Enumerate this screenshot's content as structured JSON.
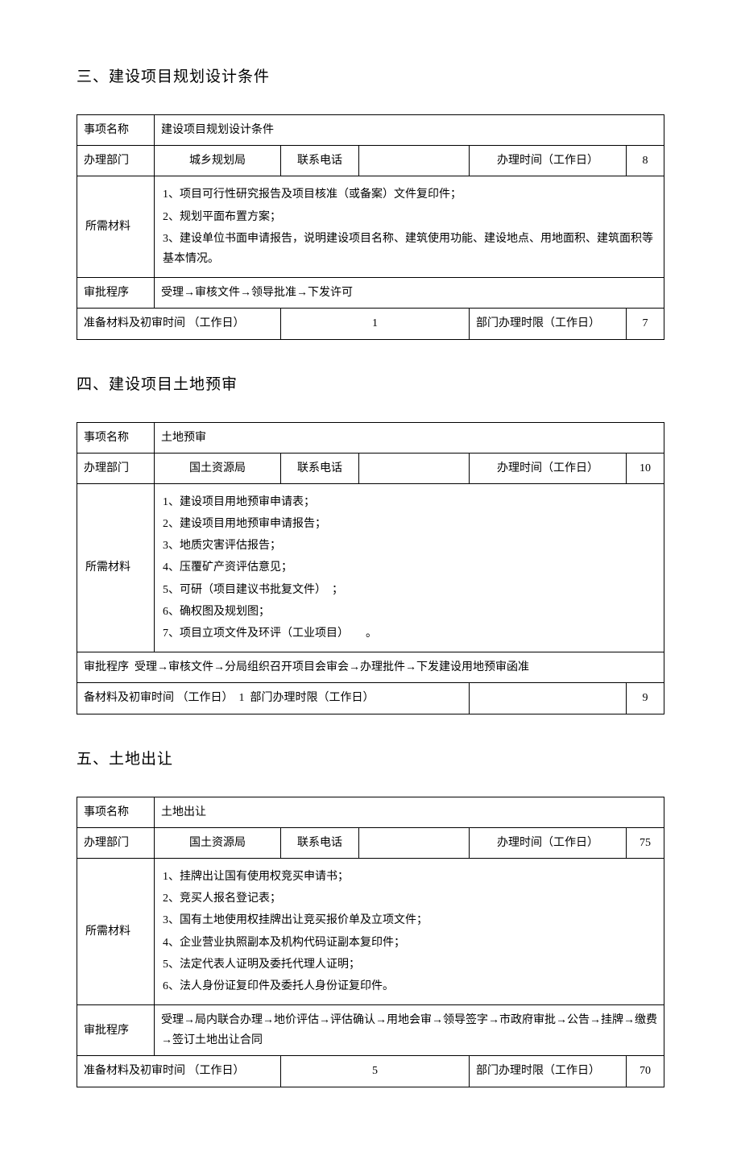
{
  "sections": [
    {
      "heading": "三、建设项目规划设计条件",
      "row_name_label": "事项名称",
      "row_name_value": "建设项目规划设计条件",
      "dept_label": "办理部门",
      "dept_value": "城乡规划局",
      "phone_label": "联系电话",
      "phone_value": "",
      "time_label": "办理时间（工作日）",
      "time_value": "8",
      "materials_label": "所需材料",
      "materials": [
        "1、项目可行性研究报告及项目核准（或备案）文件复印件；",
        "2、规划平面布置方案；",
        "3、建设单位书面申请报告，说明建设项目名称、建筑使用功能、建设地点、用地面积、建筑面积等基本情况。"
      ],
      "approval_label": "审批程序",
      "approval_value": "受理→审核文件→领导批准→下发许可",
      "prep_label": "准备材料及初审时间 （工作日）",
      "prep_value": "1",
      "dept_time_label": "部门办理时限（工作日）",
      "dept_time_value": "7"
    },
    {
      "heading": "四、建设项目土地预审",
      "row_name_label": "事项名称",
      "row_name_value": "土地预审",
      "dept_label": "办理部门",
      "dept_value": "国土资源局",
      "phone_label": "联系电话",
      "phone_value": "",
      "time_label": "办理时间（工作日）",
      "time_value": "10",
      "materials_label": "所需材料",
      "materials": [
        "1、建设项目用地预审申请表；",
        "2、建设项目用地预审申请报告；",
        "3、地质灾害评估报告；",
        "4、压覆矿产资评估意见；",
        "5、可研（项目建议书批复文件）　；",
        "6、确权图及规划图；",
        "7、项目立项文件及环评（工业项目）　　。"
      ],
      "approval_label": "审批程序",
      "approval_value": "受理→审核文件→分局组织召开项目会审会→办理批件→下发建设用地预审函准",
      "prep_label": "备材料及初审时间 （工作日）",
      "prep_value": "1",
      "dept_time_label": "部门办理时限（工作日）",
      "dept_time_value": "9"
    },
    {
      "heading": "五、土地出让",
      "row_name_label": "事项名称",
      "row_name_value": "土地出让",
      "dept_label": "办理部门",
      "dept_value": "国土资源局",
      "phone_label": "联系电话",
      "phone_value": "",
      "time_label": "办理时间（工作日）",
      "time_value": "75",
      "materials_label": "所需材料",
      "materials": [
        "1、挂牌出让国有使用权竞买申请书；",
        "2、竞买人报名登记表；",
        "3、国有土地使用权挂牌出让竞买报价单及立项文件；",
        "4、企业营业执照副本及机构代码证副本复印件；",
        "5、法定代表人证明及委托代理人证明；",
        "6、法人身份证复印件及委托人身份证复印件。"
      ],
      "approval_label": "审批程序",
      "approval_value": "受理→局内联合办理→地价评估→评估确认→用地会审→领导签字→市政府审批→公告→挂牌→缴费→签订土地出让合同",
      "prep_label": "准备材料及初审时间 （工作日）",
      "prep_value": "5",
      "dept_time_label": "部门办理时限（工作日）",
      "dept_time_value": "70"
    }
  ]
}
